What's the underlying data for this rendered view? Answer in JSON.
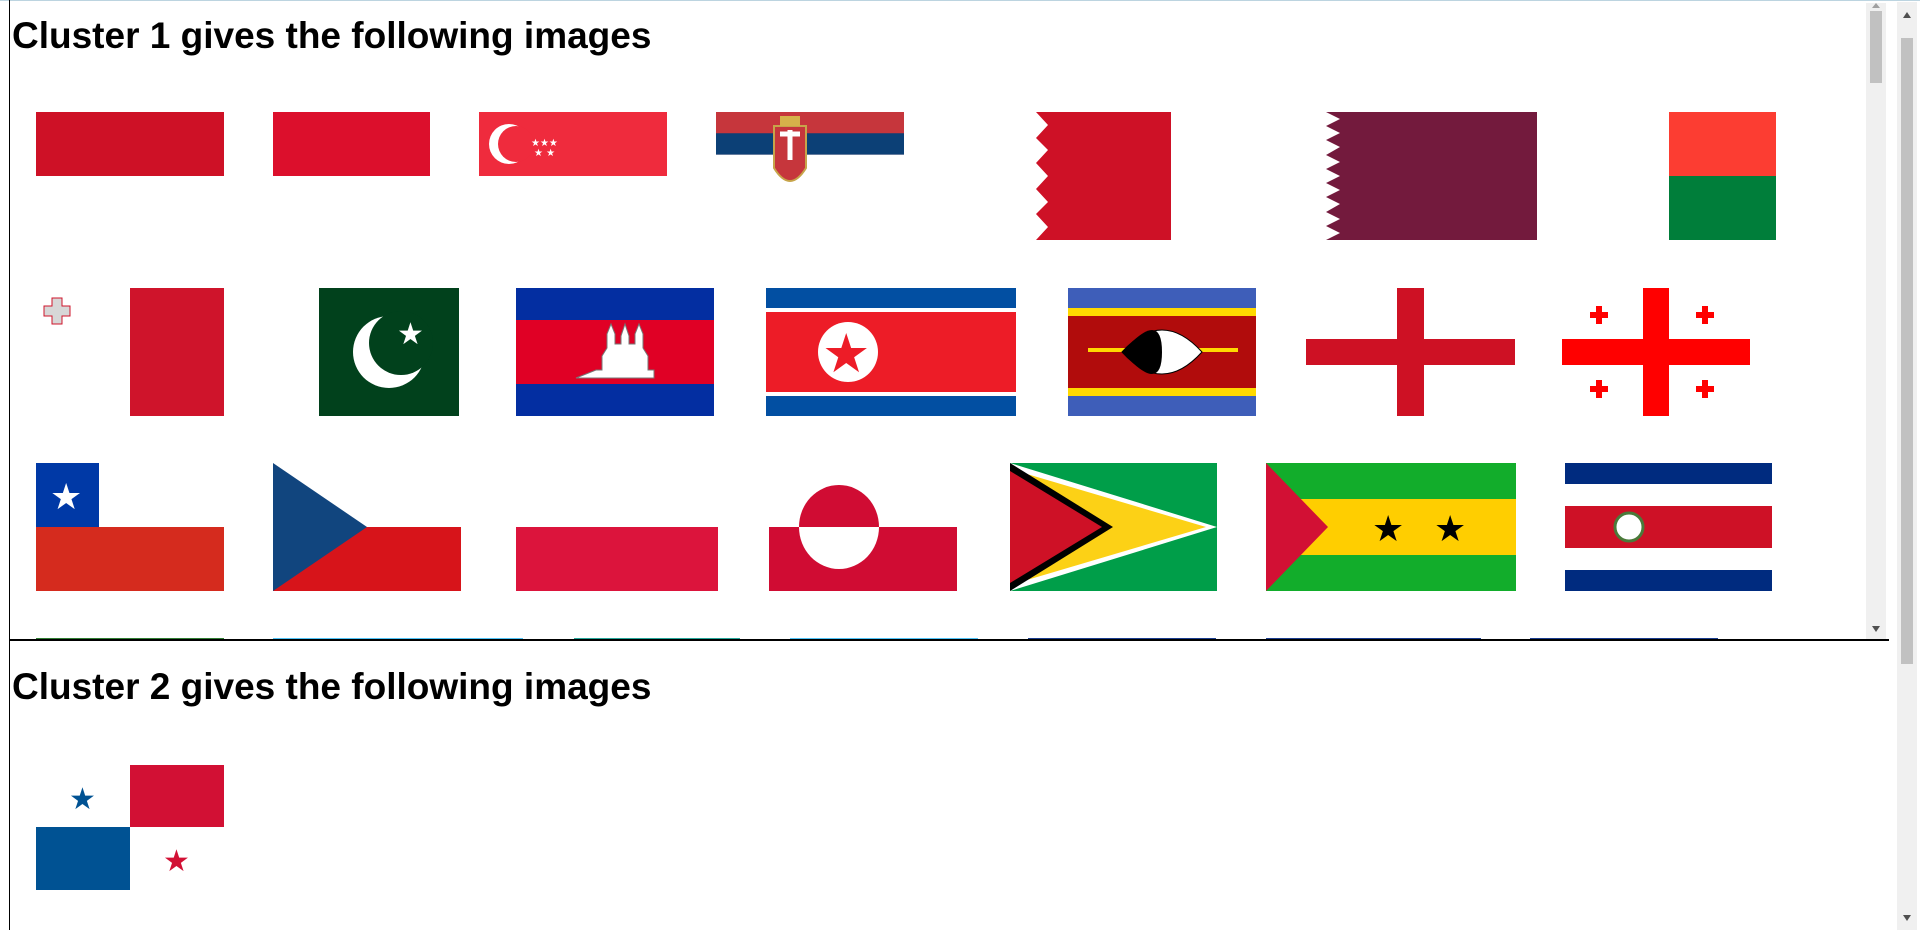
{
  "clusters": [
    {
      "title": "Cluster 1 gives the following images"
    },
    {
      "title": "Cluster 2 gives the following images"
    }
  ],
  "flags": [
    "indonesia",
    "monaco",
    "singapore",
    "serbia",
    "bahrain",
    "qatar",
    "madagascar",
    "malta",
    "pakistan",
    "cambodia",
    "north-korea",
    "eswatini",
    "england",
    "georgia",
    "chile",
    "czech-republic",
    "poland",
    "greenland",
    "guyana",
    "sao-tome-and-principe",
    "costa-rica",
    "panama"
  ],
  "colors": {
    "red": "#ce1126",
    "blue": "#0038a8",
    "green": "#009e49",
    "yellow": "#fcd116"
  }
}
